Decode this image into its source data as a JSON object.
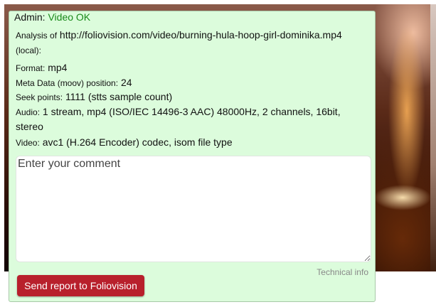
{
  "admin": {
    "label": "Admin:",
    "status": "Video OK",
    "status_color": "#1a8a1a"
  },
  "analysis": {
    "prefix": "Analysis of",
    "url": "http://foliovision.com/video/burning-hula-hoop-girl-dominika.mp4",
    "suffix": "(local):"
  },
  "details": {
    "format_label": "Format:",
    "format_value": "mp4",
    "meta_label": "Meta Data (moov) position:",
    "meta_value": "24",
    "seek_label": "Seek points:",
    "seek_value": "1111 (stts sample count)",
    "audio_label": "Audio:",
    "audio_value_line1": "1 stream, mp4 (ISO/IEC 14496-3 AAC) 48000Hz, 2 channels, 16bit,",
    "audio_value_line2": "stereo",
    "video_label": "Video:",
    "video_value": "avc1 (H.264 Encoder) codec, isom file type"
  },
  "comment": {
    "placeholder": "Enter your comment",
    "value": ""
  },
  "technical_info_label": "Technical info",
  "send_button_label": "Send report to Foliovision",
  "colors": {
    "panel_background": "#dcfcdc",
    "button_background": "#b8202c"
  }
}
